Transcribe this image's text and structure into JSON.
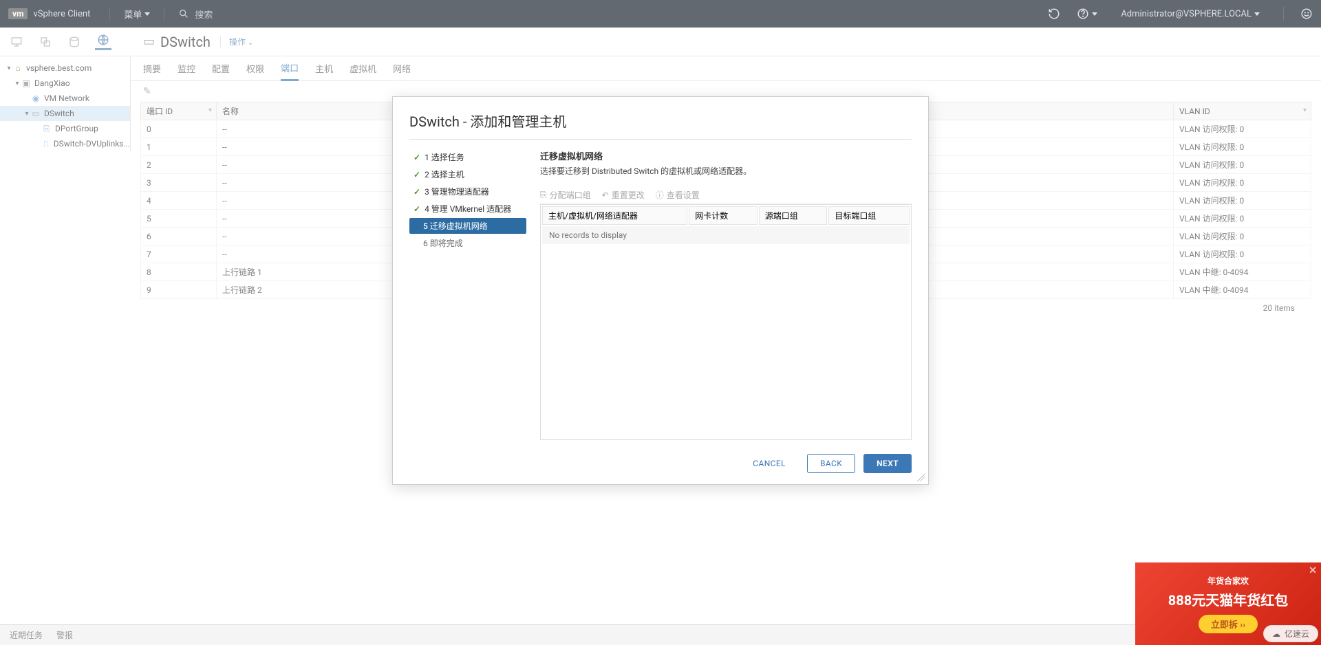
{
  "header": {
    "client_name": "vSphere Client",
    "vm_box": "vm",
    "menu_label": "菜单",
    "search_placeholder": "搜索",
    "user_label": "Administrator@VSPHERE.LOCAL"
  },
  "tree": {
    "root": "vsphere.best.com",
    "datacenter": "DangXiao",
    "network1": "VM Network",
    "dswitch": "DSwitch",
    "portgroup": "DPortGroup",
    "uplinks": "DSwitch-DVUplinks..."
  },
  "object": {
    "title": "DSwitch",
    "actions_label": "操作"
  },
  "tabs": {
    "summary": "摘要",
    "monitor": "监控",
    "configure": "配置",
    "permissions": "权限",
    "ports": "端口",
    "hosts": "主机",
    "vms": "虚拟机",
    "networks": "网络"
  },
  "grid": {
    "columns": {
      "port_id": "端口 ID",
      "name": "名称",
      "vlan_id": "VLAN ID"
    },
    "rows": [
      {
        "port": "0",
        "name": "--",
        "vlan": "VLAN 访问权限: 0"
      },
      {
        "port": "1",
        "name": "--",
        "vlan": "VLAN 访问权限: 0"
      },
      {
        "port": "2",
        "name": "--",
        "vlan": "VLAN 访问权限: 0"
      },
      {
        "port": "3",
        "name": "--",
        "vlan": "VLAN 访问权限: 0"
      },
      {
        "port": "4",
        "name": "--",
        "vlan": "VLAN 访问权限: 0"
      },
      {
        "port": "5",
        "name": "--",
        "vlan": "VLAN 访问权限: 0"
      },
      {
        "port": "6",
        "name": "--",
        "vlan": "VLAN 访问权限: 0"
      },
      {
        "port": "7",
        "name": "--",
        "vlan": "VLAN 访问权限: 0"
      },
      {
        "port": "8",
        "name": "上行链路 1",
        "vlan": "VLAN 中继: 0-4094"
      },
      {
        "port": "9",
        "name": "上行链路 2",
        "vlan": "VLAN 中继: 0-4094"
      }
    ],
    "footer_items": "20 items"
  },
  "modal": {
    "title": "DSwitch - 添加和管理主机",
    "steps": [
      {
        "n": "1",
        "label": "选择任务",
        "state": "done"
      },
      {
        "n": "2",
        "label": "选择主机",
        "state": "done"
      },
      {
        "n": "3",
        "label": "管理物理适配器",
        "state": "done"
      },
      {
        "n": "4",
        "label": "管理 VMkernel 适配器",
        "state": "done"
      },
      {
        "n": "5",
        "label": "迁移虚拟机网络",
        "state": "active"
      },
      {
        "n": "6",
        "label": "即将完成",
        "state": "pending"
      }
    ],
    "content_title": "迁移虚拟机网络",
    "content_desc": "选择要迁移到 Distributed Switch 的虚拟机或网络适配器。",
    "toolbar": {
      "assign": "分配端口组",
      "reset": "重置更改",
      "view": "查看设置"
    },
    "inner_columns": {
      "host": "主机/虚拟机/网络适配器",
      "nic": "网卡计数",
      "src": "源端口组",
      "dst": "目标端口组"
    },
    "empty_text": "No records to display",
    "buttons": {
      "cancel": "CANCEL",
      "back": "BACK",
      "next": "NEXT"
    }
  },
  "bottom": {
    "recent": "近期任务",
    "alarms": "警报"
  },
  "ad": {
    "small": "年货合家欢",
    "big": "888元天猫年货红包",
    "pill": "立即拆 ››"
  },
  "brand_badge": "亿速云"
}
